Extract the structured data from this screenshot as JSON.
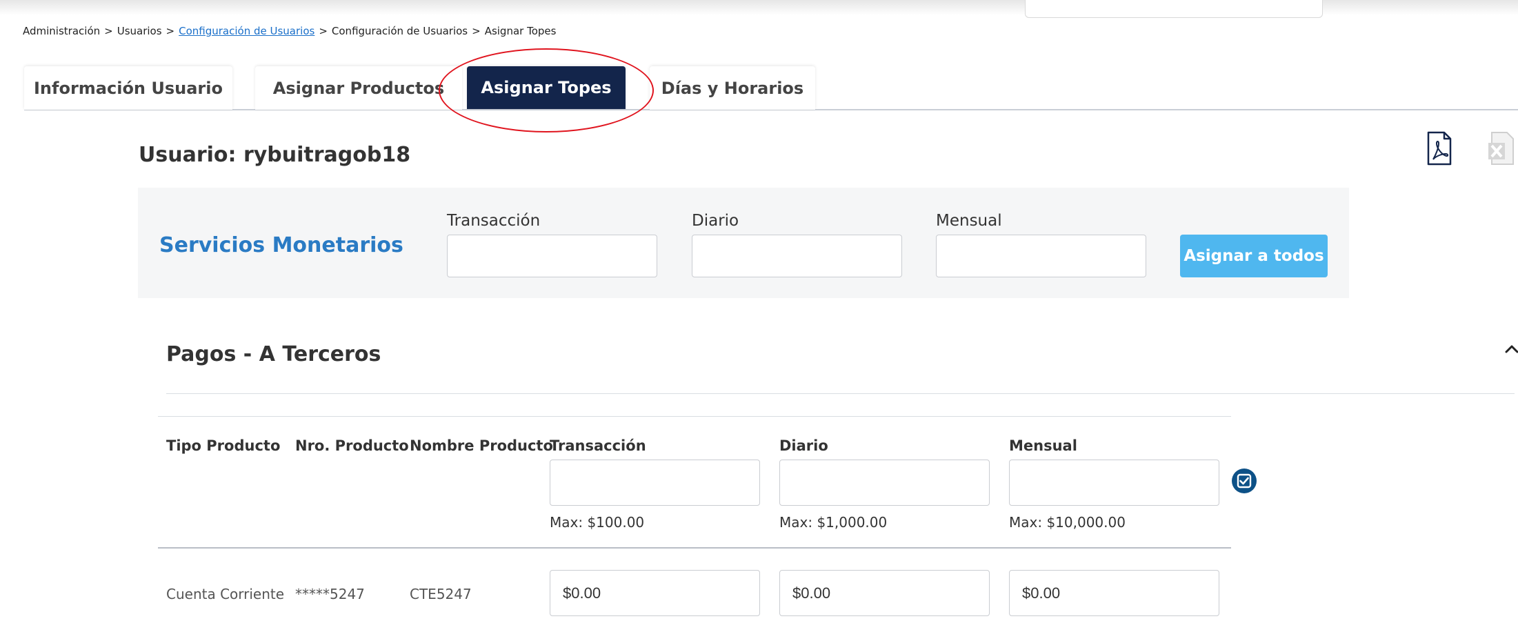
{
  "breadcrumb": {
    "item1": "Administración",
    "item2": "Usuarios",
    "item3": "Configuración de Usuarios",
    "item4": "Configuración de Usuarios",
    "item5": "Asignar Topes",
    "separator": ">"
  },
  "tabs": [
    {
      "label": "Información Usuario"
    },
    {
      "label": "Asignar Productos"
    },
    {
      "label": "Asignar Topes"
    },
    {
      "label": "Días y Horarios"
    }
  ],
  "active_tab": "Asignar Topes",
  "icons": {
    "pdf": "pdf-icon",
    "excel": "excel-icon",
    "chevron": "chevron-up-icon",
    "check": "check-circle-icon"
  },
  "user_title": "Usuario: rybuitragob18",
  "services": {
    "title": "Servicios Monetarios",
    "labels": {
      "transaction": "Transacción",
      "daily": "Diario",
      "monthly": "Mensual"
    },
    "values": {
      "transaction": "",
      "daily": "",
      "monthly": ""
    },
    "assign_button": "Asignar a todos"
  },
  "section": {
    "title": "Pagos - A Terceros",
    "headers": {
      "tipo": "Tipo Producto",
      "nro": "Nro. Producto",
      "nombre": "Nombre Producto",
      "transaction": "Transacción",
      "daily": "Diario",
      "monthly": "Mensual"
    },
    "bulk_values": {
      "transaction": "",
      "daily": "",
      "monthly": ""
    },
    "max": {
      "transaction": "Max: $100.00",
      "daily": "Max: $1,000.00",
      "monthly": "Max: $10,000.00"
    },
    "rows": [
      {
        "tipo": "Cuenta Corriente",
        "nro": "*****5247",
        "nombre": "CTE5247",
        "transaction": "$0.00",
        "daily": "$0.00",
        "monthly": "$0.00"
      }
    ]
  },
  "colors": {
    "active_tab": "#13254b",
    "accent_blue": "#2a7bc4",
    "button": "#4fb7ef",
    "highlight": "#e0141e"
  }
}
